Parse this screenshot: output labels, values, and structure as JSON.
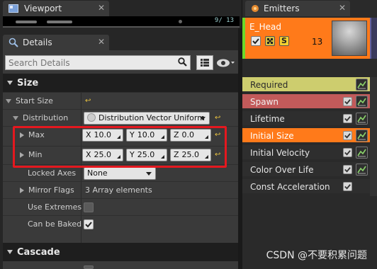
{
  "viewport": {
    "tab_label": "Viewport",
    "close_glyph": "✕",
    "counter": "9/ 13"
  },
  "details": {
    "tab_label": "Details",
    "close_glyph": "✕",
    "search": {
      "placeholder": "Search Details"
    },
    "size_category": "Size",
    "cascade_category": "Cascade",
    "start_size_label": "Start Size",
    "distribution_label": "Distribution",
    "distribution_value": "Distribution Vector Uniform",
    "max": {
      "label": "Max",
      "x_axis": "X",
      "x": "10.0",
      "y_axis": "Y",
      "y": "10.0",
      "z_axis": "Z",
      "z": "0.0"
    },
    "min": {
      "label": "Min",
      "x_axis": "X",
      "x": "25.0",
      "y_axis": "Y",
      "y": "25.0",
      "z_axis": "Z",
      "z": "25.0"
    },
    "locked_axes_label": "Locked Axes",
    "locked_axes_value": "None",
    "mirror_flags_label": "Mirror Flags",
    "mirror_flags_value": "3 Array elements",
    "use_extremes_label": "Use Extremes",
    "use_extremes_checked": false,
    "can_be_baked_label": "Can be Baked",
    "can_be_baked_checked": true,
    "reset_glyph": "↩"
  },
  "emitters": {
    "tab_label": "Emitters",
    "close_glyph": "✕",
    "emitter_name": "E_Head",
    "solo_label": "S",
    "particle_count": "13",
    "modules": [
      {
        "label": "Required",
        "color": "#cdcd6e",
        "text_color": "#2a2a2a",
        "has_enable": false,
        "has_curve": true
      },
      {
        "label": "Spawn",
        "color": "#c25a5a",
        "text_color": "#f0f0f0",
        "has_enable": true,
        "has_curve": true
      },
      {
        "label": "Lifetime",
        "color": "#2e2e2e",
        "text_color": "#e6e6e6",
        "has_enable": true,
        "has_curve": true
      },
      {
        "label": "Initial Size",
        "color": "#ff7a1a",
        "text_color": "#ffffff",
        "has_enable": true,
        "has_curve": true
      },
      {
        "label": "Initial Velocity",
        "color": "#2e2e2e",
        "text_color": "#e6e6e6",
        "has_enable": true,
        "has_curve": true
      },
      {
        "label": "Color Over Life",
        "color": "#2e2e2e",
        "text_color": "#e6e6e6",
        "has_enable": true,
        "has_curve": true
      },
      {
        "label": "Const Acceleration",
        "color": "#2e2e2e",
        "text_color": "#e6e6e6",
        "has_enable": true,
        "has_curve": false
      }
    ]
  },
  "watermark": "CSDN @不要积累问题",
  "colors": {
    "highlight": "#e4181f",
    "emitter_accent": "#ff7a1a",
    "reset_arrow": "#e8c240"
  }
}
